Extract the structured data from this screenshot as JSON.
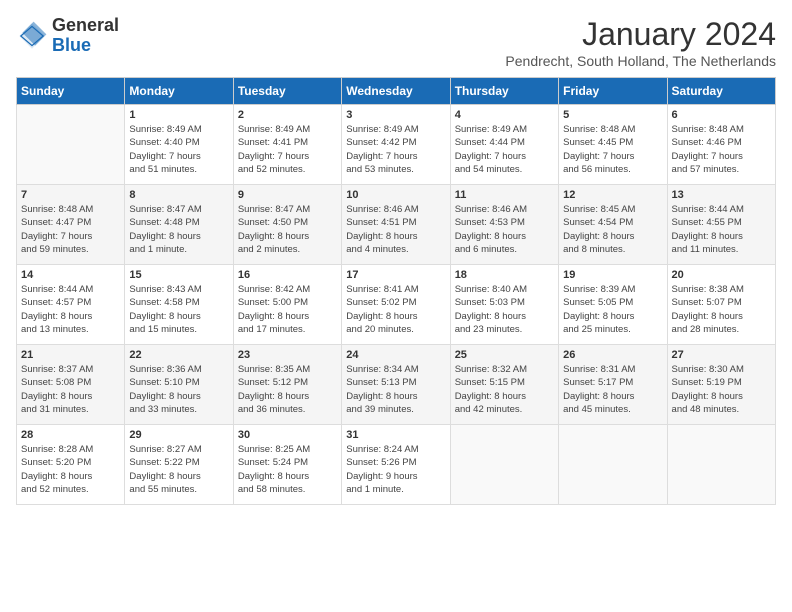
{
  "header": {
    "logo_general": "General",
    "logo_blue": "Blue",
    "month_title": "January 2024",
    "location": "Pendrecht, South Holland, The Netherlands"
  },
  "days_of_week": [
    "Sunday",
    "Monday",
    "Tuesday",
    "Wednesday",
    "Thursday",
    "Friday",
    "Saturday"
  ],
  "weeks": [
    [
      {
        "day": "",
        "info": ""
      },
      {
        "day": "1",
        "info": "Sunrise: 8:49 AM\nSunset: 4:40 PM\nDaylight: 7 hours\nand 51 minutes."
      },
      {
        "day": "2",
        "info": "Sunrise: 8:49 AM\nSunset: 4:41 PM\nDaylight: 7 hours\nand 52 minutes."
      },
      {
        "day": "3",
        "info": "Sunrise: 8:49 AM\nSunset: 4:42 PM\nDaylight: 7 hours\nand 53 minutes."
      },
      {
        "day": "4",
        "info": "Sunrise: 8:49 AM\nSunset: 4:44 PM\nDaylight: 7 hours\nand 54 minutes."
      },
      {
        "day": "5",
        "info": "Sunrise: 8:48 AM\nSunset: 4:45 PM\nDaylight: 7 hours\nand 56 minutes."
      },
      {
        "day": "6",
        "info": "Sunrise: 8:48 AM\nSunset: 4:46 PM\nDaylight: 7 hours\nand 57 minutes."
      }
    ],
    [
      {
        "day": "7",
        "info": "Sunrise: 8:48 AM\nSunset: 4:47 PM\nDaylight: 7 hours\nand 59 minutes."
      },
      {
        "day": "8",
        "info": "Sunrise: 8:47 AM\nSunset: 4:48 PM\nDaylight: 8 hours\nand 1 minute."
      },
      {
        "day": "9",
        "info": "Sunrise: 8:47 AM\nSunset: 4:50 PM\nDaylight: 8 hours\nand 2 minutes."
      },
      {
        "day": "10",
        "info": "Sunrise: 8:46 AM\nSunset: 4:51 PM\nDaylight: 8 hours\nand 4 minutes."
      },
      {
        "day": "11",
        "info": "Sunrise: 8:46 AM\nSunset: 4:53 PM\nDaylight: 8 hours\nand 6 minutes."
      },
      {
        "day": "12",
        "info": "Sunrise: 8:45 AM\nSunset: 4:54 PM\nDaylight: 8 hours\nand 8 minutes."
      },
      {
        "day": "13",
        "info": "Sunrise: 8:44 AM\nSunset: 4:55 PM\nDaylight: 8 hours\nand 11 minutes."
      }
    ],
    [
      {
        "day": "14",
        "info": "Sunrise: 8:44 AM\nSunset: 4:57 PM\nDaylight: 8 hours\nand 13 minutes."
      },
      {
        "day": "15",
        "info": "Sunrise: 8:43 AM\nSunset: 4:58 PM\nDaylight: 8 hours\nand 15 minutes."
      },
      {
        "day": "16",
        "info": "Sunrise: 8:42 AM\nSunset: 5:00 PM\nDaylight: 8 hours\nand 17 minutes."
      },
      {
        "day": "17",
        "info": "Sunrise: 8:41 AM\nSunset: 5:02 PM\nDaylight: 8 hours\nand 20 minutes."
      },
      {
        "day": "18",
        "info": "Sunrise: 8:40 AM\nSunset: 5:03 PM\nDaylight: 8 hours\nand 23 minutes."
      },
      {
        "day": "19",
        "info": "Sunrise: 8:39 AM\nSunset: 5:05 PM\nDaylight: 8 hours\nand 25 minutes."
      },
      {
        "day": "20",
        "info": "Sunrise: 8:38 AM\nSunset: 5:07 PM\nDaylight: 8 hours\nand 28 minutes."
      }
    ],
    [
      {
        "day": "21",
        "info": "Sunrise: 8:37 AM\nSunset: 5:08 PM\nDaylight: 8 hours\nand 31 minutes."
      },
      {
        "day": "22",
        "info": "Sunrise: 8:36 AM\nSunset: 5:10 PM\nDaylight: 8 hours\nand 33 minutes."
      },
      {
        "day": "23",
        "info": "Sunrise: 8:35 AM\nSunset: 5:12 PM\nDaylight: 8 hours\nand 36 minutes."
      },
      {
        "day": "24",
        "info": "Sunrise: 8:34 AM\nSunset: 5:13 PM\nDaylight: 8 hours\nand 39 minutes."
      },
      {
        "day": "25",
        "info": "Sunrise: 8:32 AM\nSunset: 5:15 PM\nDaylight: 8 hours\nand 42 minutes."
      },
      {
        "day": "26",
        "info": "Sunrise: 8:31 AM\nSunset: 5:17 PM\nDaylight: 8 hours\nand 45 minutes."
      },
      {
        "day": "27",
        "info": "Sunrise: 8:30 AM\nSunset: 5:19 PM\nDaylight: 8 hours\nand 48 minutes."
      }
    ],
    [
      {
        "day": "28",
        "info": "Sunrise: 8:28 AM\nSunset: 5:20 PM\nDaylight: 8 hours\nand 52 minutes."
      },
      {
        "day": "29",
        "info": "Sunrise: 8:27 AM\nSunset: 5:22 PM\nDaylight: 8 hours\nand 55 minutes."
      },
      {
        "day": "30",
        "info": "Sunrise: 8:25 AM\nSunset: 5:24 PM\nDaylight: 8 hours\nand 58 minutes."
      },
      {
        "day": "31",
        "info": "Sunrise: 8:24 AM\nSunset: 5:26 PM\nDaylight: 9 hours\nand 1 minute."
      },
      {
        "day": "",
        "info": ""
      },
      {
        "day": "",
        "info": ""
      },
      {
        "day": "",
        "info": ""
      }
    ]
  ]
}
